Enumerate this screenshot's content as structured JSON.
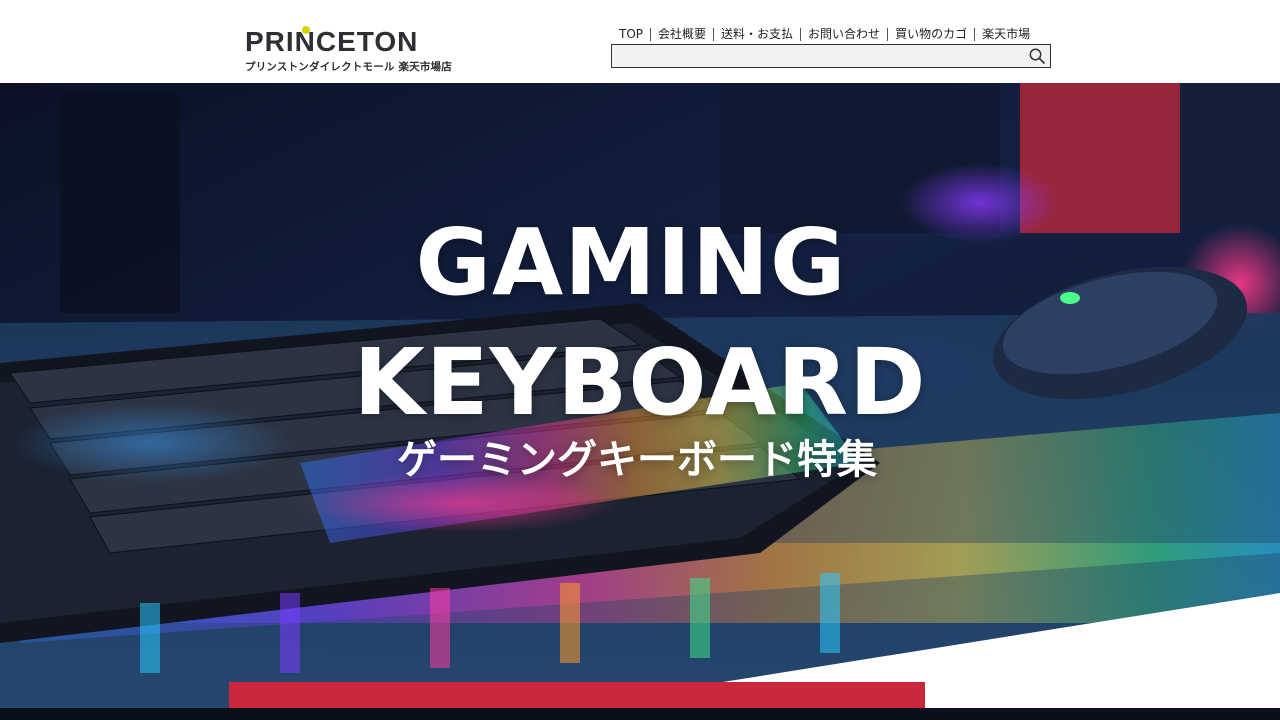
{
  "header": {
    "logo": {
      "wordmark": "PRINCETON",
      "subtitle": "プリンストンダイレクトモール 楽天市場店"
    },
    "nav": [
      {
        "label": "TOP"
      },
      {
        "label": "会社概要"
      },
      {
        "label": "送料・お支払"
      },
      {
        "label": "お問い合わせ"
      },
      {
        "label": "買い物のカゴ"
      },
      {
        "label": "楽天市場"
      }
    ],
    "search": {
      "value": "",
      "placeholder": "",
      "icon": "search-icon"
    }
  },
  "hero": {
    "line1": "GAMING",
    "line2": "KEYBOARD",
    "line3": "ゲーミングキーボード特集"
  },
  "colors": {
    "accent_red": "#c8283a",
    "logo_dot": "#d6d200",
    "text_dark": "#2e2e33"
  }
}
